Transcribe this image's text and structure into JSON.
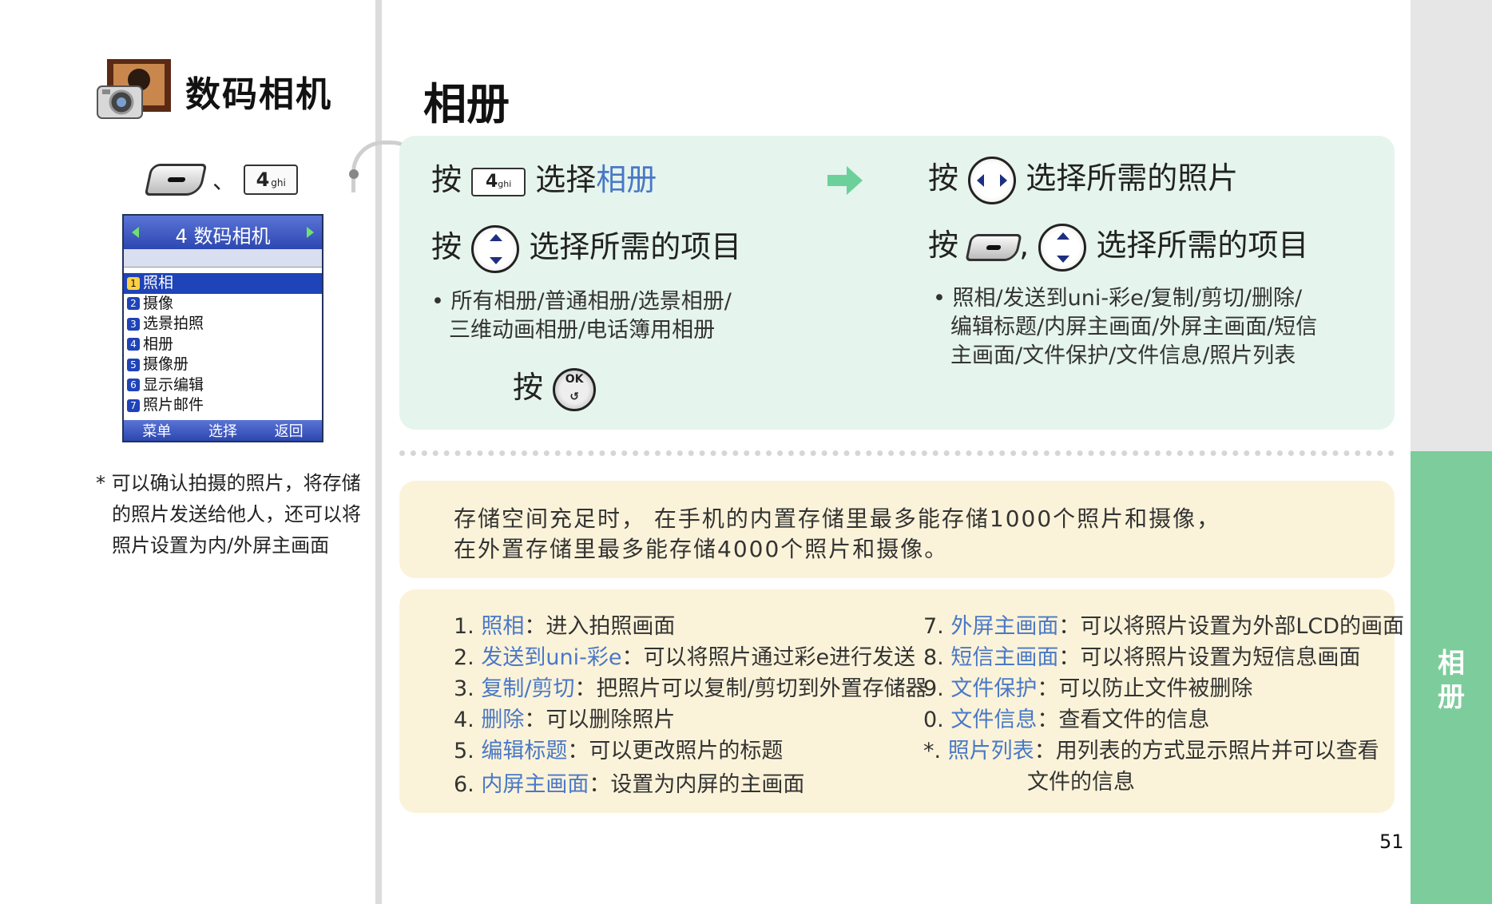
{
  "section": {
    "title": "数码相机",
    "separator": "、",
    "key_number": "4",
    "key_letters": "ghi"
  },
  "phone_screen": {
    "title": "4 数码相机",
    "items": [
      {
        "num": "1",
        "label": "照相"
      },
      {
        "num": "2",
        "label": "摄像"
      },
      {
        "num": "3",
        "label": "选景拍照"
      },
      {
        "num": "4",
        "label": "相册"
      },
      {
        "num": "5",
        "label": "摄像册"
      },
      {
        "num": "6",
        "label": "显示编辑"
      },
      {
        "num": "7",
        "label": "照片邮件"
      }
    ],
    "bottom": [
      "菜单",
      "选择",
      "返回"
    ]
  },
  "left_note": [
    "* 可以确认拍摄的照片，将存储",
    "的照片发送给他人，还可以将",
    "照片设置为内/外屏主画面"
  ],
  "page_title": "相册",
  "steps": {
    "s1_press": "按",
    "s1_key_number": "4",
    "s1_key_letters": "ghi",
    "s1_select": "选择",
    "s1_target": "相册",
    "s2_press": "按",
    "s2_text": "选择所需的项目",
    "s2_bullet": [
      "所有相册/普通相册/选景相册/",
      "三维动画相册/电话簿用相册"
    ],
    "s3_press": "按",
    "ok_label": "OK",
    "s4_press": "按",
    "s4_text": "选择所需的照片",
    "s5_press": "按",
    "s5_comma": ",",
    "s5_text": "选择所需的项目",
    "s5_bullet": [
      "照相/发送到uni-彩e/复制/剪切/删除/",
      "编辑标题/内屏主画面/外屏主画面/短信",
      "主画面/文件保护/文件信息/照片列表"
    ]
  },
  "info": [
    "存储空间充足时， 在手机的内置存储里最多能存储1000个照片和摄像，",
    "在外置存储里最多能存储4000个照片和摄像。"
  ],
  "legend_left": [
    {
      "num": "1.",
      "term": "照相",
      "sep": "：",
      "desc": "进入拍照画面"
    },
    {
      "num": "2.",
      "term": "发送到uni-彩e",
      "sep": "：",
      "desc": "可以将照片通过彩e进行发送"
    },
    {
      "num": "3.",
      "term": "复制/剪切",
      "sep": "：",
      "desc": "把照片可以复制/剪切到外置存储器"
    },
    {
      "num": "4.",
      "term": "删除",
      "sep": "：",
      "desc": "可以删除照片"
    },
    {
      "num": "5.",
      "term": "编辑标题",
      "sep": "：",
      "desc": "可以更改照片的标题"
    },
    {
      "num": "6.",
      "term": "内屏主画面",
      "sep": "：",
      "desc": "设置为内屏的主画面"
    }
  ],
  "legend_right": [
    {
      "num": "7.",
      "term": "外屏主画面",
      "sep": "：",
      "desc": "可以将照片设置为外部LCD的画面"
    },
    {
      "num": "8.",
      "term": "短信主画面",
      "sep": "：",
      "desc": "可以将照片设置为短信息画面"
    },
    {
      "num": "9.",
      "term": "文件保护",
      "sep": "：",
      "desc": "可以防止文件被删除"
    },
    {
      "num": "0.",
      "term": "文件信息",
      "sep": "：",
      "desc": "查看文件的信息"
    },
    {
      "num": "*.",
      "term": "照片列表",
      "sep": "：",
      "desc": "用列表的方式显示照片并可以查看",
      "desc2": "文件的信息"
    }
  ],
  "side_tab": [
    "相",
    "册"
  ],
  "page_number": "51",
  "colors": {
    "accent_blue": "#4a78c7",
    "tab_green": "#7dcc9c",
    "step_bg": "#e5f4ec",
    "info_bg": "#fbf3d9"
  }
}
